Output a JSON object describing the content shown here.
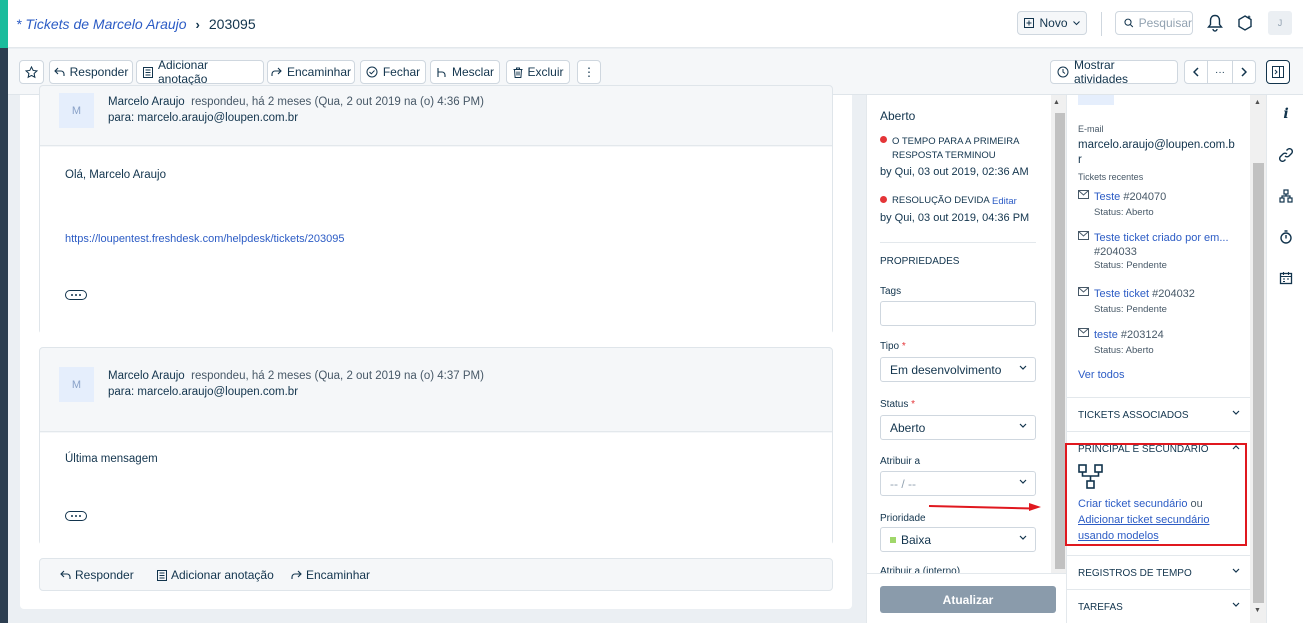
{
  "header": {
    "breadcrumb_link": "* Tickets de Marcelo Araujo",
    "breadcrumb_current": "203095",
    "novo_label": "Novo",
    "search_label": "Pesquisar",
    "avatar_initial": "J"
  },
  "toolbar": {
    "reply": "Responder",
    "add_note": "Adicionar anotação",
    "forward": "Encaminhar",
    "close": "Fechar",
    "merge": "Mesclar",
    "delete": "Excluir",
    "more": "⋮",
    "show_activities": "Mostrar atividades",
    "more_horizontal": "···"
  },
  "messages": [
    {
      "avatar": "M",
      "author": "Marcelo Araujo",
      "meta": "respondeu, há 2 meses (Qua, 2 out 2019 na (o) 4:36 PM)",
      "to_label": "para:",
      "to": "marcelo.araujo@loupen.com.br",
      "body": "Olá, Marcelo Araujo",
      "link": "https://loupentest.freshdesk.com/helpdesk/tickets/203095"
    },
    {
      "avatar": "M",
      "author": "Marcelo Araujo",
      "meta": "respondeu, há 2 meses (Qua, 2 out 2019 na (o) 4:37 PM)",
      "to_label": "para:",
      "to": "marcelo.araujo@loupen.com.br",
      "body": "Última mensagem"
    }
  ],
  "reply_bar": {
    "reply": "Responder",
    "add_note": "Adicionar anotação",
    "forward": "Encaminhar"
  },
  "properties": {
    "status_title": "Aberto",
    "sla1_label": "O TEMPO PARA A PRIMEIRA",
    "sla1_label2": "RESPOSTA TERMINOU",
    "sla1_by": "by Qui, 03 out 2019, 02:36 AM",
    "sla2_label": "RESOLUÇÃO DEVIDA",
    "sla2_edit": "Editar",
    "sla2_by": "by Qui, 03 out 2019, 04:36 PM",
    "section_title": "PROPRIEDADES",
    "tags_label": "Tags",
    "tags_value": "",
    "type_label": "Tipo",
    "type_value": "Em desenvolvimento",
    "status_label": "Status",
    "status_value": "Aberto",
    "assign_label": "Atribuir a",
    "assign_value": "-- / --",
    "priority_label": "Prioridade",
    "priority_value": "Baixa",
    "priority_color": "#a0d76a",
    "internal_label": "Atribuir a (interno)",
    "update_button": "Atualizar",
    "required_mark": "*"
  },
  "contact": {
    "email_label": "E-mail",
    "email": "marcelo.araujo@loupen.com.br",
    "recent_label": "Tickets recentes",
    "tickets": [
      {
        "title": "Teste",
        "number": "#204070",
        "status": "Status: Aberto"
      },
      {
        "title": "Teste ticket criado por em...",
        "number": "#204033",
        "status": "Status: Pendente"
      },
      {
        "title": "Teste ticket",
        "number": "#204032",
        "status": "Status: Pendente"
      },
      {
        "title": "teste",
        "number": "#203124",
        "status": "Status: Aberto"
      }
    ],
    "see_all": "Ver todos",
    "sections": {
      "associated": "TICKETS ASSOCIADOS",
      "parent_child": "PRINCIPAL E SECUNDÁRIO",
      "time_logs": "REGISTROS DE TEMPO",
      "tasks": "TAREFAS"
    },
    "create_child": "Criar ticket secundário",
    "or": "ou",
    "add_child_line1": "Adicionar ticket secundário",
    "add_child_line2": "usando modelos"
  },
  "colors": {
    "accent": "#2c5cc5",
    "annotation_red": "#e0181f",
    "sla_red": "#e43538"
  }
}
